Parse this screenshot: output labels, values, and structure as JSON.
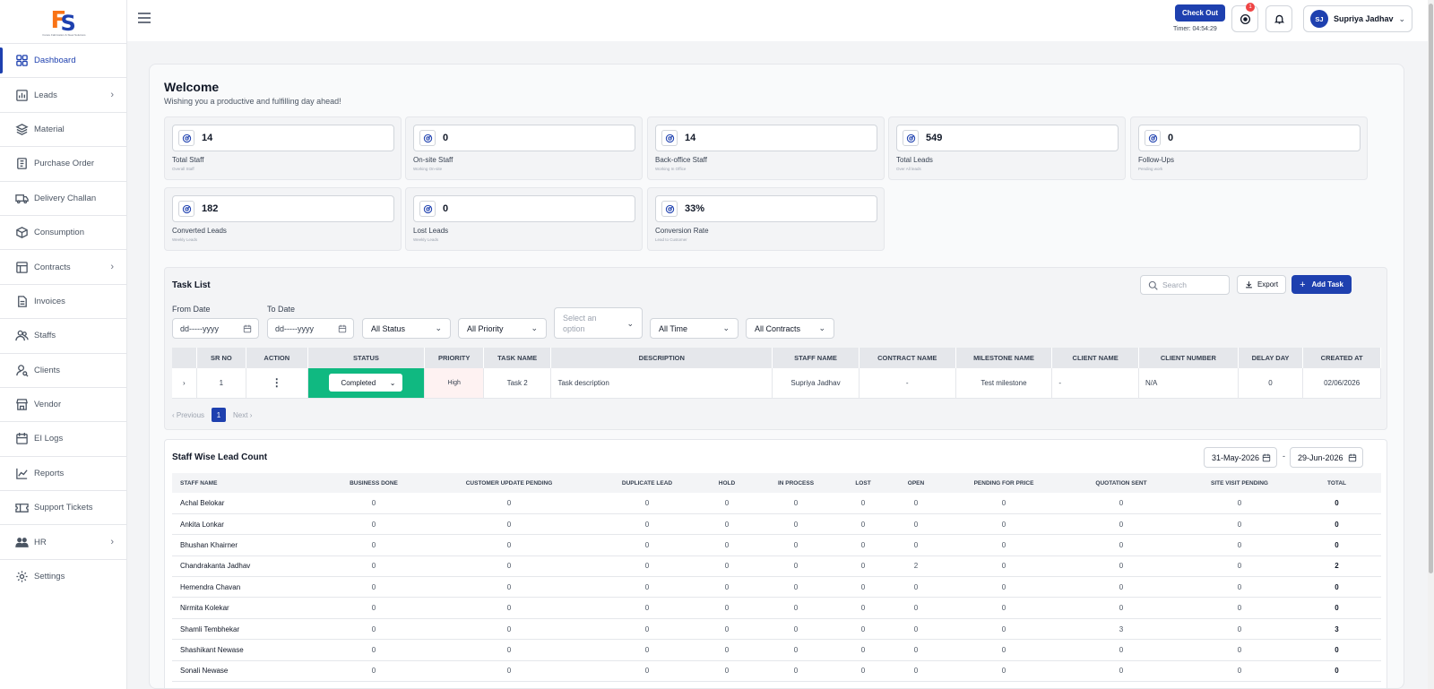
{
  "brand": {
    "logo_tagline": "Future Fabrication & Steel Solutions"
  },
  "sidebar": {
    "items": [
      {
        "label": "Dashboard",
        "icon": "dashboard-icon",
        "active": true,
        "has_children": false
      },
      {
        "label": "Leads",
        "icon": "chart-icon",
        "active": false,
        "has_children": true
      },
      {
        "label": "Material",
        "icon": "layers-icon",
        "active": false,
        "has_children": false
      },
      {
        "label": "Purchase Order",
        "icon": "clipboard-icon",
        "active": false,
        "has_children": false
      },
      {
        "label": "Delivery Challan",
        "icon": "truck-icon",
        "active": false,
        "has_children": false
      },
      {
        "label": "Consumption",
        "icon": "box-icon",
        "active": false,
        "has_children": false
      },
      {
        "label": "Contracts",
        "icon": "contract-icon",
        "active": false,
        "has_children": true
      },
      {
        "label": "Invoices",
        "icon": "invoice-icon",
        "active": false,
        "has_children": false
      },
      {
        "label": "Staffs",
        "icon": "users-icon",
        "active": false,
        "has_children": false
      },
      {
        "label": "Clients",
        "icon": "user-search-icon",
        "active": false,
        "has_children": false
      },
      {
        "label": "Vendor",
        "icon": "store-icon",
        "active": false,
        "has_children": false
      },
      {
        "label": "EI Logs",
        "icon": "calendar-icon",
        "active": false,
        "has_children": false
      },
      {
        "label": "Reports",
        "icon": "line-chart-icon",
        "active": false,
        "has_children": false
      },
      {
        "label": "Support Tickets",
        "icon": "ticket-icon",
        "active": false,
        "has_children": false
      },
      {
        "label": "HR",
        "icon": "team-icon",
        "active": false,
        "has_children": true
      },
      {
        "label": "Settings",
        "icon": "gear-icon",
        "active": false,
        "has_children": false
      }
    ]
  },
  "topbar": {
    "checkout_label": "Check Out",
    "timer": "Timer: 04:54:29",
    "notification_count": "1",
    "user_initials": "SJ",
    "user_name": "Supriya Jadhav"
  },
  "welcome": {
    "title": "Welcome",
    "subtitle": "Wishing you a productive and fulfilling day ahead!"
  },
  "stats": [
    {
      "value": "14",
      "label": "Total Staff",
      "sub": "Overall Staff"
    },
    {
      "value": "0",
      "label": "On-site Staff",
      "sub": "Working On-site"
    },
    {
      "value": "14",
      "label": "Back-office Staff",
      "sub": "Working In Office"
    },
    {
      "value": "549",
      "label": "Total Leads",
      "sub": "Over All leads"
    },
    {
      "value": "0",
      "label": "Follow-Ups",
      "sub": "Pending work"
    },
    {
      "value": "182",
      "label": "Converted Leads",
      "sub": "Weekly Leads"
    },
    {
      "value": "0",
      "label": "Lost Leads",
      "sub": "Weekly Leads"
    },
    {
      "value": "33%",
      "label": "Conversion Rate",
      "sub": "Lead to Customer"
    }
  ],
  "task_list": {
    "title": "Task List",
    "search_placeholder": "Search",
    "export_label": "Export",
    "add_task_label": "Add Task",
    "from_date_label": "From Date",
    "to_date_label": "To Date",
    "date_placeholder": "dd-----yyyy",
    "status_filter": "All Status",
    "priority_filter": "All Priority",
    "select_placeholder": "Select an option",
    "time_filter": "All Time",
    "contracts_filter": "All Contracts",
    "columns": [
      "",
      "SR NO",
      "ACTION",
      "STATUS",
      "PRIORITY",
      "TASK NAME",
      "DESCRIPTION",
      "STAFF NAME",
      "CONTRACT NAME",
      "MILESTONE NAME",
      "CLIENT NAME",
      "CLIENT NUMBER",
      "DELAY DAY",
      "CREATED AT"
    ],
    "row": {
      "sr_no": "1",
      "status": "Completed",
      "priority": "High",
      "task_name": "Task 2",
      "description": "Task description",
      "staff_name": "Supriya Jadhav",
      "contract_name": "-",
      "milestone_name": "Test milestone",
      "client_name": "-",
      "client_number": "N/A",
      "delay_day": "0",
      "created_at": "02/06/2026"
    },
    "pager": {
      "previous": "Previous",
      "page": "1",
      "next": "Next"
    }
  },
  "staff_wise": {
    "title": "Staff Wise Lead Count",
    "date_from": "31-May-2026",
    "date_to": "29-Jun-2026",
    "separator": "-",
    "columns": [
      "STAFF NAME",
      "BUSINESS DONE",
      "CUSTOMER UPDATE PENDING",
      "DUPLICATE LEAD",
      "HOLD",
      "IN PROCESS",
      "LOST",
      "OPEN",
      "PENDING FOR PRICE",
      "QUOTATION SENT",
      "SITE VISIT PENDING",
      "TOTAL"
    ],
    "rows": [
      [
        "Achal Belokar",
        "0",
        "0",
        "0",
        "0",
        "0",
        "0",
        "0",
        "0",
        "0",
        "0",
        "0"
      ],
      [
        "Ankita Lonkar",
        "0",
        "0",
        "0",
        "0",
        "0",
        "0",
        "0",
        "0",
        "0",
        "0",
        "0"
      ],
      [
        "Bhushan Khairner",
        "0",
        "0",
        "0",
        "0",
        "0",
        "0",
        "0",
        "0",
        "0",
        "0",
        "0"
      ],
      [
        "Chandrakanta Jadhav",
        "0",
        "0",
        "0",
        "0",
        "0",
        "0",
        "2",
        "0",
        "0",
        "0",
        "2"
      ],
      [
        "Hemendra Chavan",
        "0",
        "0",
        "0",
        "0",
        "0",
        "0",
        "0",
        "0",
        "0",
        "0",
        "0"
      ],
      [
        "Nirmita Kolekar",
        "0",
        "0",
        "0",
        "0",
        "0",
        "0",
        "0",
        "0",
        "0",
        "0",
        "0"
      ],
      [
        "Shamli Tembhekar",
        "0",
        "0",
        "0",
        "0",
        "0",
        "0",
        "0",
        "0",
        "3",
        "0",
        "3"
      ],
      [
        "Shashikant Newase",
        "0",
        "0",
        "0",
        "0",
        "0",
        "0",
        "0",
        "0",
        "0",
        "0",
        "0"
      ],
      [
        "Sonali Newase",
        "0",
        "0",
        "0",
        "0",
        "0",
        "0",
        "0",
        "0",
        "0",
        "0",
        "0"
      ]
    ]
  },
  "colors": {
    "primary": "#1e40af",
    "success": "#10b981",
    "logo_orange": "#f97316",
    "badge": "#ef4444"
  }
}
